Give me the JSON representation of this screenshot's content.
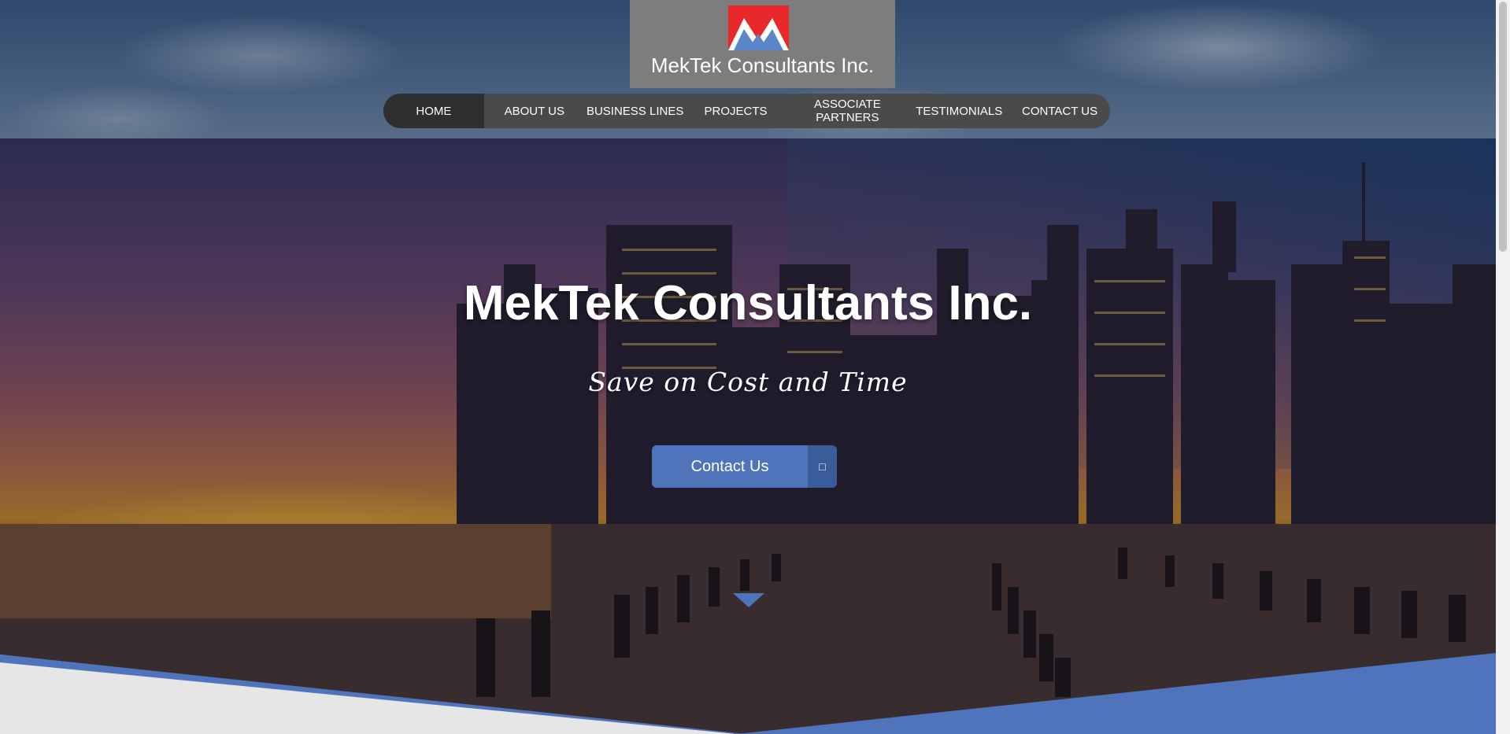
{
  "header": {
    "logo_text": "MekTek Consultants Inc."
  },
  "nav": {
    "items": [
      {
        "label": "HOME"
      },
      {
        "label": "ABOUT US"
      },
      {
        "label": "BUSINESS LINES"
      },
      {
        "label": "PROJECTS"
      },
      {
        "label": "ASSOCIATE PARTNERS"
      },
      {
        "label": "TESTIMONIALS"
      },
      {
        "label": "CONTACT US"
      }
    ]
  },
  "hero": {
    "title": "MekTek Consultants Inc.",
    "tagline": "Save on Cost and Time",
    "cta_label": "Contact Us",
    "cta_icon": "□"
  },
  "colors": {
    "accent": "#4f74bb",
    "nav_bg": "#4a4a4a",
    "nav_active": "#2f2f2f",
    "logo_box": "#7d7d7d",
    "logo_red": "#e8282b"
  },
  "icons": {
    "logo": "mektek-logo-icon",
    "cta": "square-icon",
    "scroll": "triangle-down-icon"
  }
}
